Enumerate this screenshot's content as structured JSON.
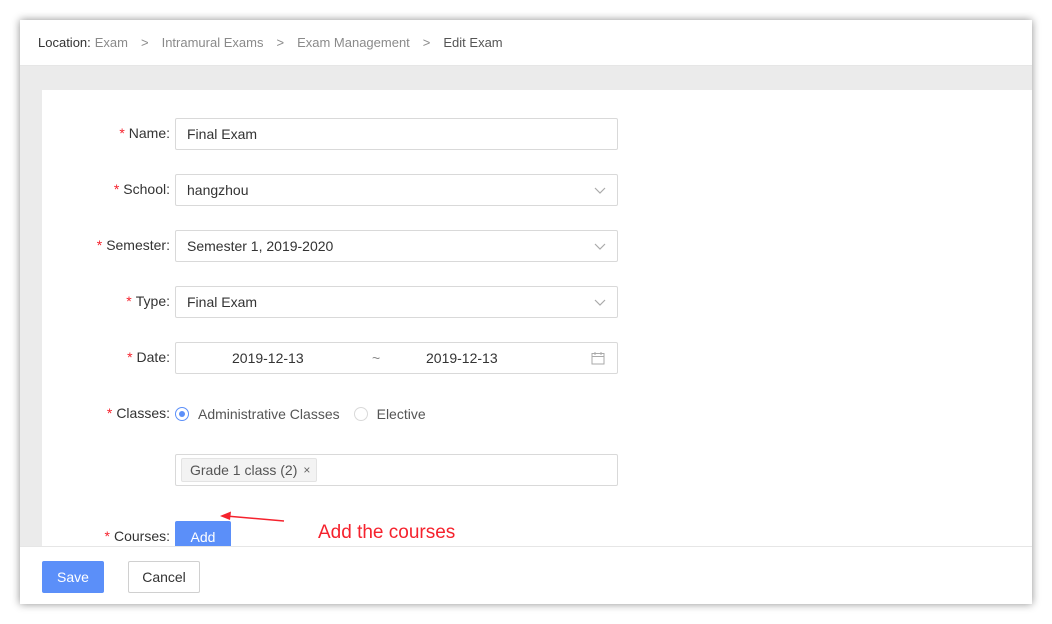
{
  "breadcrumb": {
    "label": "Location:",
    "items": [
      "Exam",
      "Intramural Exams",
      "Exam Management"
    ],
    "separator": ">",
    "current": "Edit Exam"
  },
  "form": {
    "required_mark": "*",
    "name": {
      "label": "Name:",
      "value": "Final Exam"
    },
    "school": {
      "label": "School:",
      "value": "hangzhou"
    },
    "semester": {
      "label": "Semester:",
      "value": "Semester 1, 2019-2020"
    },
    "type": {
      "label": "Type:",
      "value": "Final Exam"
    },
    "date": {
      "label": "Date:",
      "start": "2019-12-13",
      "separator": "~",
      "end": "2019-12-13"
    },
    "classes": {
      "label": "Classes:",
      "options": [
        {
          "label": "Administrative Classes",
          "checked": true
        },
        {
          "label": "Elective",
          "checked": false
        }
      ],
      "selected_tags": [
        "Grade 1 class (2)"
      ],
      "tag_close_glyph": "×"
    },
    "courses": {
      "label": "Courses:",
      "add_button": "Add"
    }
  },
  "annotation": {
    "text": "Add the courses",
    "color": "#f5222d"
  },
  "footer": {
    "save_label": "Save",
    "cancel_label": "Cancel"
  },
  "colors": {
    "primary": "#5b8ff9",
    "required": "#f5222d"
  },
  "icons": {
    "select_arrow": "chevron-down-icon",
    "date_picker": "calendar-icon",
    "tag_close": "close-icon"
  }
}
